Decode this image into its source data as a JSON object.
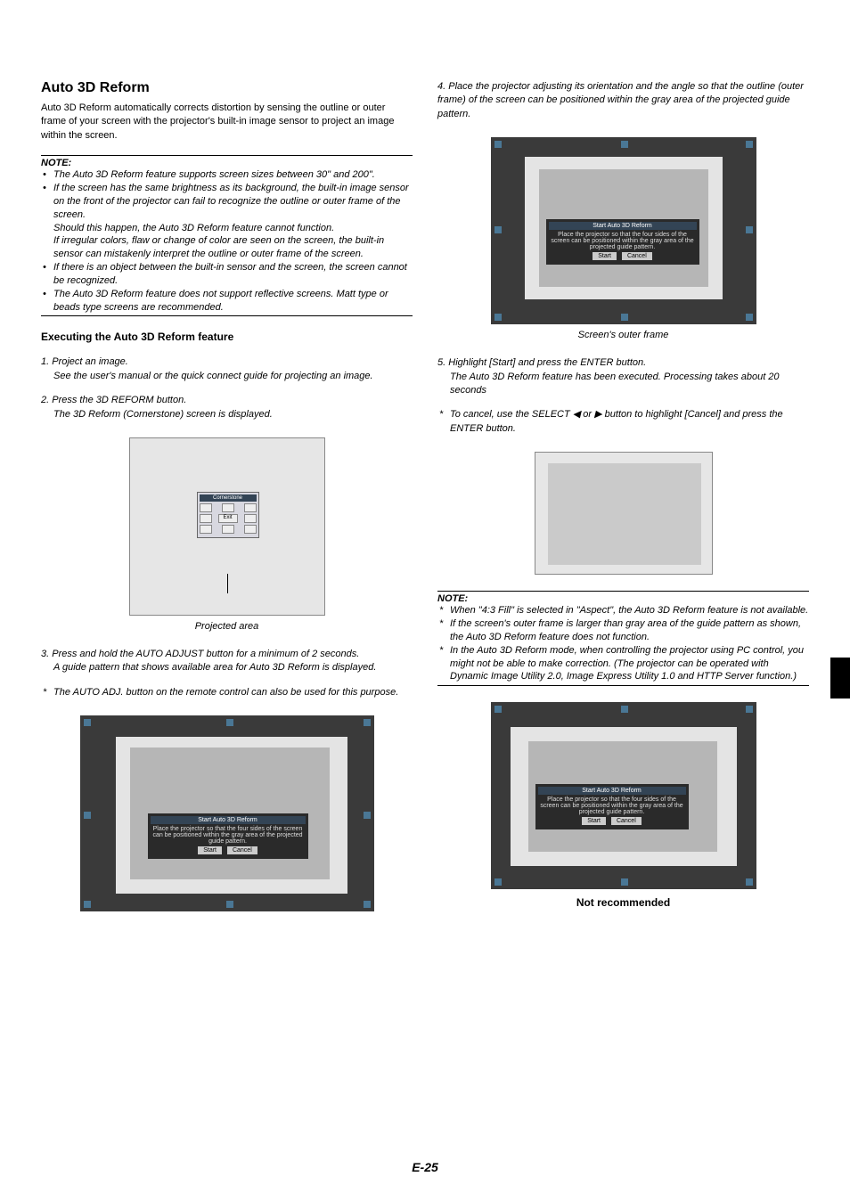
{
  "left": {
    "title": "Auto 3D Reform",
    "intro": "Auto 3D Reform automatically corrects distortion by sensing the outline or outer frame of your screen with the projector's built-in image sensor to project an image within the screen.",
    "note_head": "NOTE:",
    "notes": [
      "The Auto 3D Reform feature supports screen sizes between 30\" and 200\".",
      "If the screen has the same brightness as its background, the built-in image sensor on the front of the projector can fail to recognize the outline or outer frame of the screen.\nShould this happen, the Auto 3D Reform feature cannot function.\nIf irregular colors, flaw or change of color are seen on the screen, the built-in sensor can mistakenly interpret the outline or outer frame of the screen.",
      "If there is an object between the built-in sensor and the screen, the screen cannot be recognized.",
      "The Auto 3D Reform feature does not support reflective screens. Matt type or beads type screens are recommended."
    ],
    "sub_head": "Executing the Auto 3D Reform feature",
    "step1_num": "1.",
    "step1_a": "Project an image.",
    "step1_b": "See the user's manual or the quick connect guide for projecting an image.",
    "step2_num": "2.",
    "step2_a": "Press the 3D REFORM button.",
    "step2_b": "The 3D Reform (Cornerstone) screen is displayed.",
    "dialog1_title": "Cornerstone",
    "dialog1_exit": "Exit",
    "fig1_caption": "Projected area",
    "step3_num": "3.",
    "step3_a": "Press and hold the AUTO ADJUST button for a minimum of 2 seconds.",
    "step3_b": "A guide pattern that shows available area for Auto 3D Reform is displayed.",
    "aster3": "The AUTO ADJ. button on the remote control can also be used for this purpose."
  },
  "right": {
    "step4_num": "4.",
    "step4_a": "Place the projector adjusting its orientation and the angle so that the outline (outer frame) of the screen can be positioned within the gray area of the projected guide pattern.",
    "fig2_caption": "Screen's outer frame",
    "step5_num": "5.",
    "step5_a": "Highlight [Start] and press the ENTER button.",
    "step5_b": "The Auto 3D Reform feature has been executed. Processing takes about 20 seconds",
    "aster5": "To cancel, use the SELECT ◀ or ▶ button to highlight [Cancel] and press the ENTER button.",
    "note_head": "NOTE:",
    "notes2": [
      "When \"4:3 Fill\" is selected in \"Aspect\", the Auto 3D Reform feature is not available.",
      "If the screen's outer frame is larger than gray area of the guide pattern as shown, the Auto 3D Reform feature does not function.",
      "In the Auto 3D Reform mode, when controlling the projector using PC control, you might not be able to make correction. (The projector can be operated with Dynamic Image Utility 2.0, Image Express Utility 1.0 and HTTP Server function.)"
    ],
    "dlg_title": "Start Auto 3D Reform",
    "dlg_text": "Place the projector so that the four sides of the screen can be positioned within the gray area of the projected guide pattern.",
    "dlg_start": "Start",
    "dlg_cancel": "Cancel",
    "not_rec": "Not recommended"
  },
  "page_num": "E-25"
}
